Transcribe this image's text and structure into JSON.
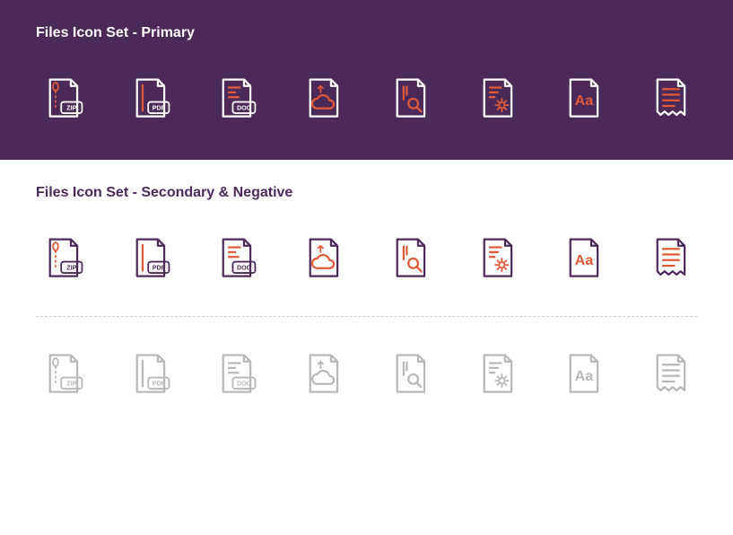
{
  "sections": {
    "primary": {
      "title": "Files Icon Set - Primary"
    },
    "secondary": {
      "title": "Files Icon Set - Secondary & Negative"
    }
  },
  "icons": [
    {
      "name": "file-zip-icon",
      "badge": "ZIP"
    },
    {
      "name": "file-pdf-icon",
      "badge": "PDF"
    },
    {
      "name": "file-doc-icon",
      "badge": "DOC"
    },
    {
      "name": "file-cloud-icon",
      "badge": ""
    },
    {
      "name": "file-search-icon",
      "badge": ""
    },
    {
      "name": "file-settings-icon",
      "badge": ""
    },
    {
      "name": "file-font-icon",
      "badge": "Aa"
    },
    {
      "name": "file-receipt-icon",
      "badge": ""
    }
  ],
  "palettes": {
    "primary": {
      "outline": "#ffffff",
      "accent": "#e05a3a"
    },
    "secondary": {
      "outline": "#4b2a5a",
      "accent": "#e05a3a"
    },
    "negative": {
      "outline": "#b8b8b8",
      "accent": "#b8b8b8"
    }
  }
}
